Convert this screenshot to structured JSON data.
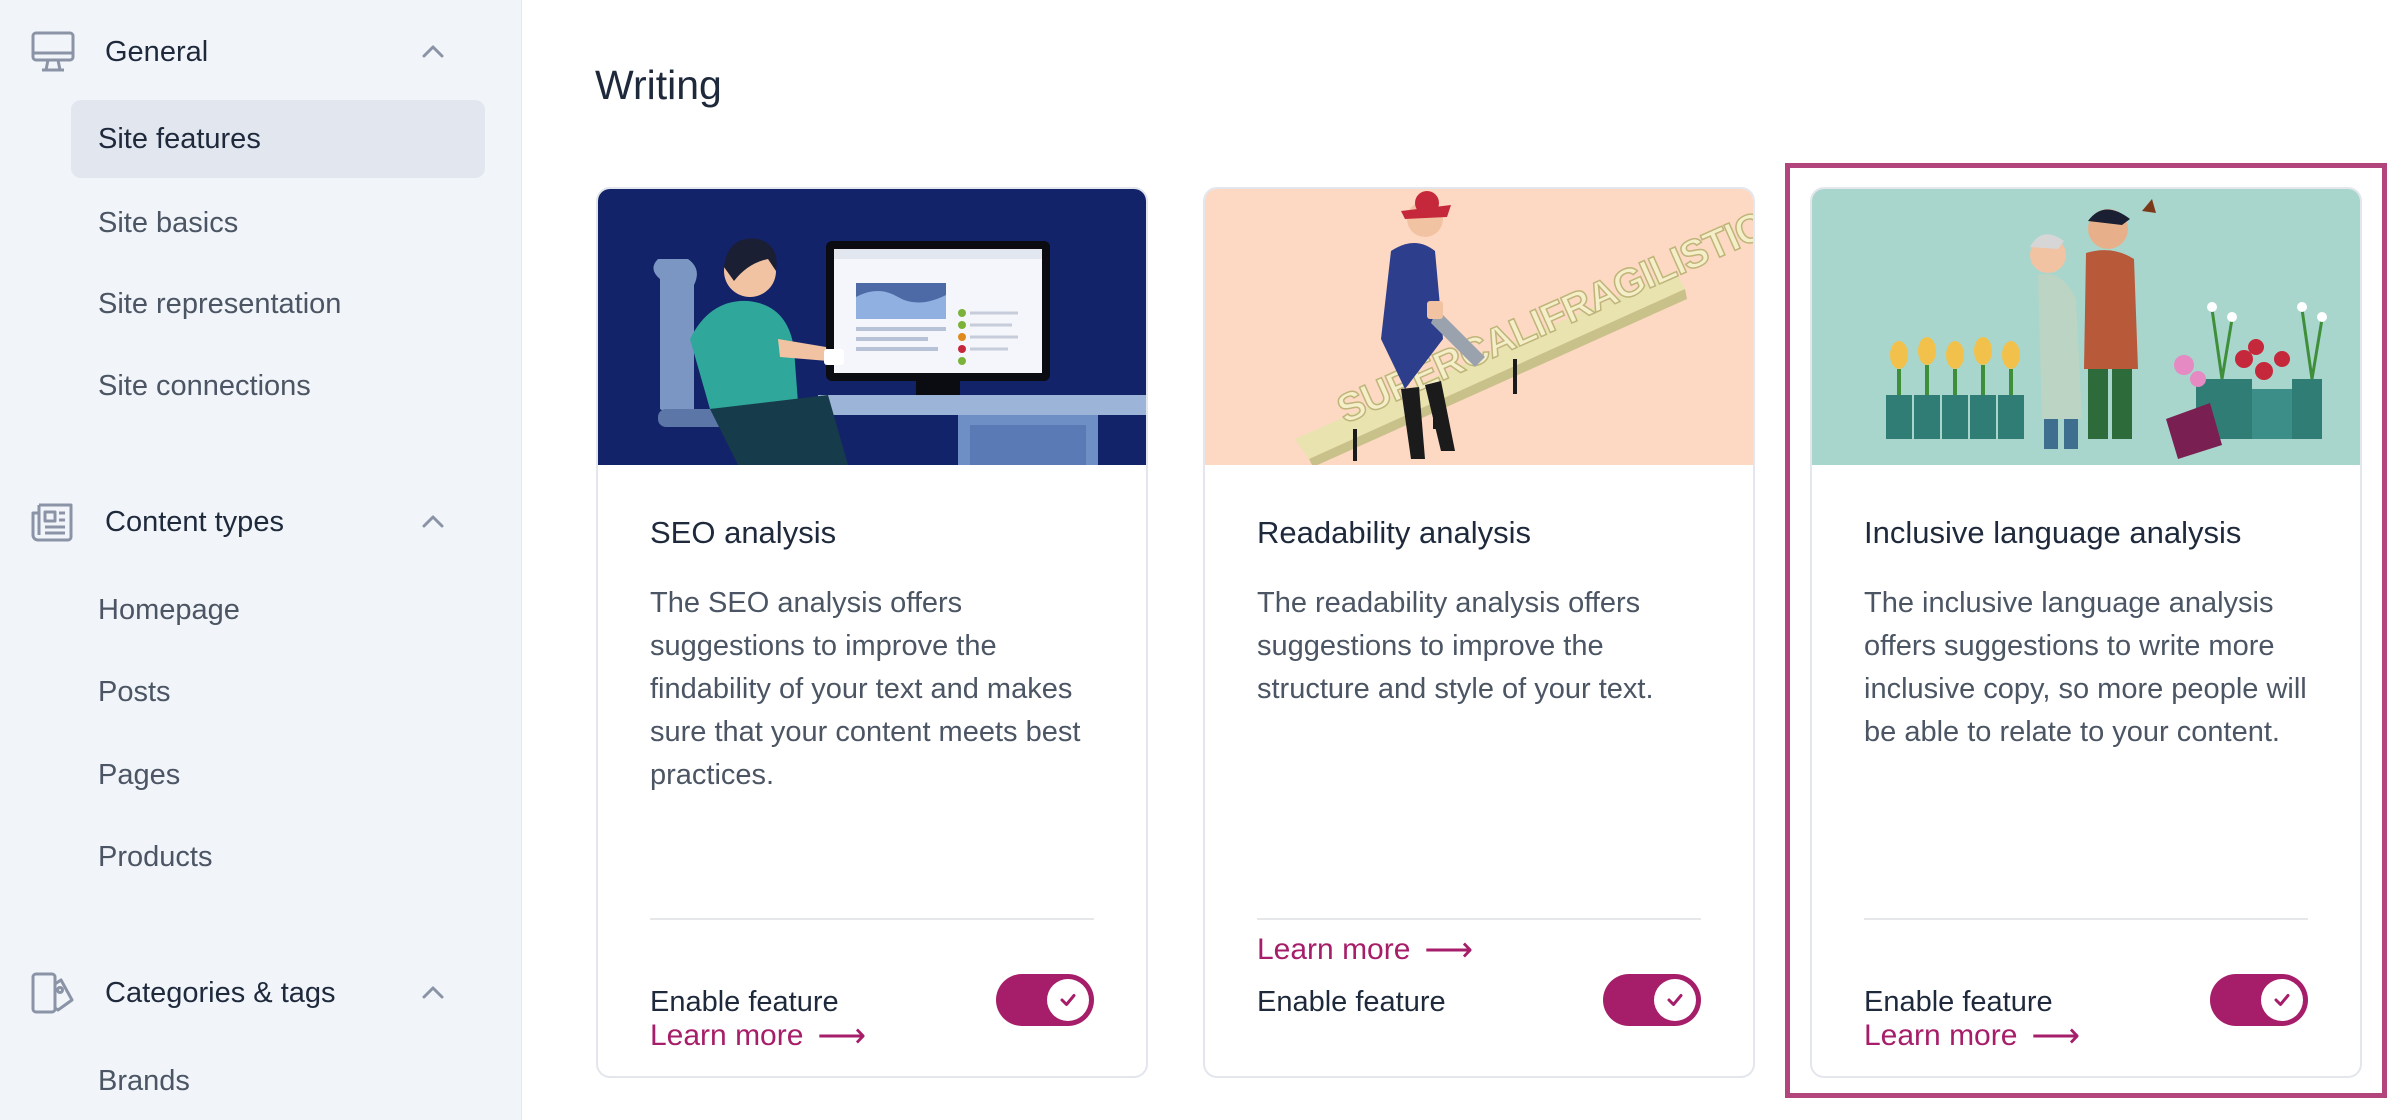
{
  "sidebar": {
    "sections": [
      {
        "label": "General",
        "icon": "monitor-icon",
        "items": [
          {
            "label": "Site features",
            "active": true
          },
          {
            "label": "Site basics"
          },
          {
            "label": "Site representation"
          },
          {
            "label": "Site connections"
          }
        ]
      },
      {
        "label": "Content types",
        "icon": "newspaper-icon",
        "items": [
          {
            "label": "Homepage"
          },
          {
            "label": "Posts"
          },
          {
            "label": "Pages"
          },
          {
            "label": "Products"
          }
        ]
      },
      {
        "label": "Categories & tags",
        "icon": "tag-document-icon",
        "items": [
          {
            "label": "Brands"
          }
        ]
      }
    ]
  },
  "main": {
    "title": "Writing",
    "cards": [
      {
        "title": "SEO analysis",
        "description": "The SEO analysis offers suggestions to improve the findability of your text and makes sure that your content meets best practices.",
        "learn_more": "Learn more",
        "arrow": "⟶",
        "enable_label": "Enable feature",
        "enabled": true,
        "illustration": "seo-analysis-illustration"
      },
      {
        "title": "Readability analysis",
        "description": "The readability analysis offers suggestions to improve the structure and style of your text.",
        "learn_more": "Learn more",
        "arrow": "⟶",
        "enable_label": "Enable feature",
        "enabled": true,
        "illustration": "readability-analysis-illustration",
        "illustration_word": "SUPERCALIFRAGILISTICEXPIALIDOCIOUS"
      },
      {
        "title": "Inclusive language analysis",
        "description": "The inclusive language analysis offers suggestions to write more inclusive copy, so more people will be able to relate to your content.",
        "learn_more": "Learn more",
        "arrow": "⟶",
        "enable_label": "Enable feature",
        "enabled": true,
        "illustration": "inclusive-language-illustration",
        "highlighted": true
      }
    ]
  },
  "colors": {
    "accent": "#a61e69",
    "highlight_border": "#b2457c",
    "sidebar_bg": "#f1f4f9",
    "active_item_bg": "#e1e6ef"
  }
}
